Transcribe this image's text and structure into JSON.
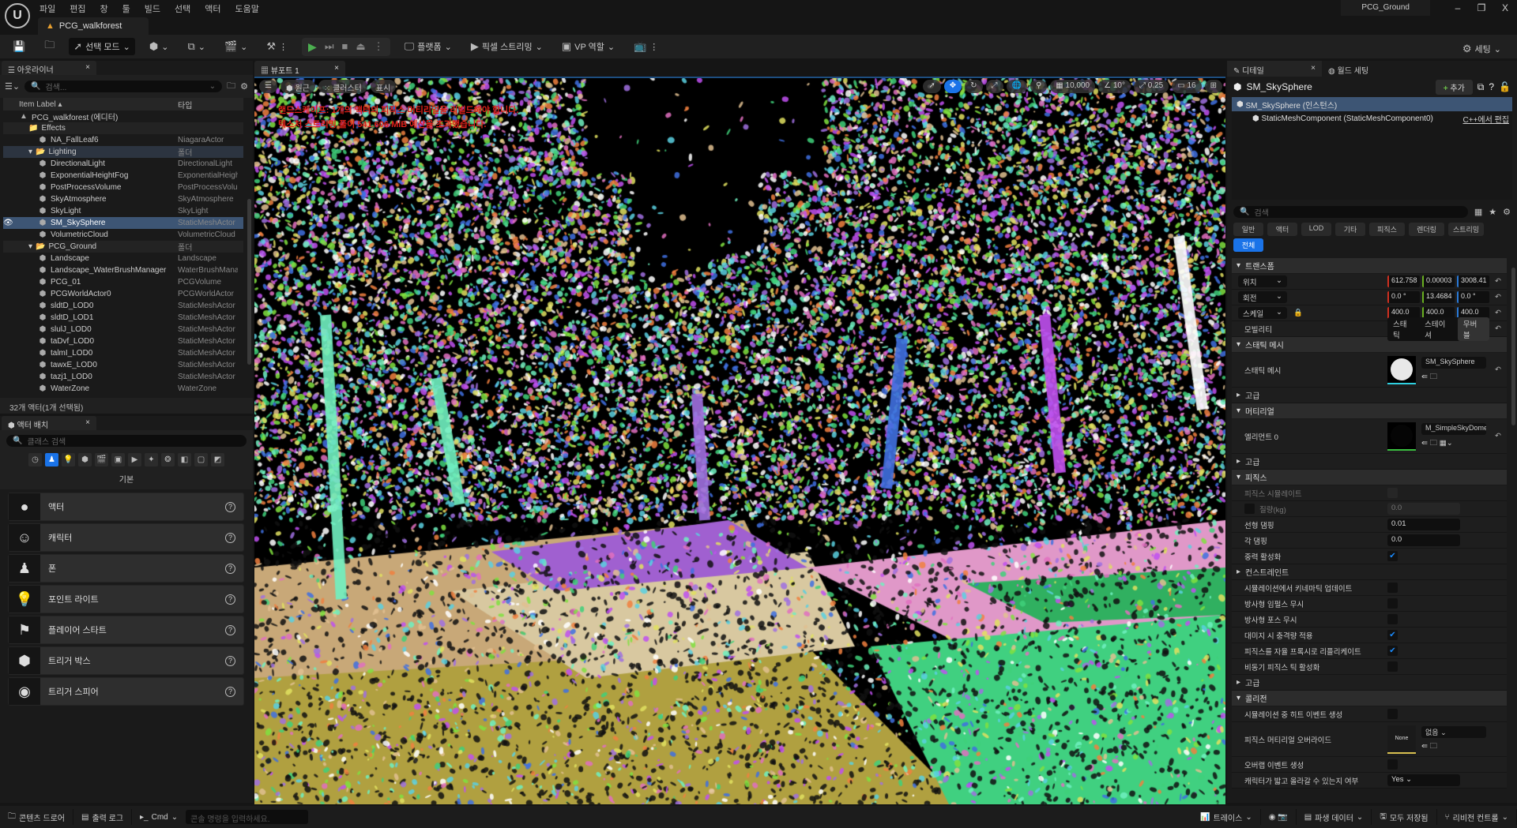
{
  "menu": [
    "파일",
    "편집",
    "창",
    "툴",
    "빌드",
    "선택",
    "액터",
    "도움말"
  ],
  "document_tab": "PCG_walkforest",
  "project_name": "PCG_Ground",
  "window_controls": [
    "–",
    "❐",
    "X"
  ],
  "toolbar": {
    "select_mode": "선택 모드",
    "platform": "플랫폼",
    "pixel_streaming": "픽셀 스트리밍",
    "vp_role": "VP 역할",
    "settings": "세팅"
  },
  "outliner": {
    "tab": "아웃라이너",
    "search_placeholder": "검색...",
    "col_label": "Item Label ▴",
    "col_type": "타입",
    "rows": [
      {
        "label": "PCG_walkforest (에디터)",
        "type": "",
        "indent": 1,
        "kind": "world"
      },
      {
        "label": "Effects",
        "type": "",
        "indent": 2,
        "kind": "folder"
      },
      {
        "label": "NA_FallLeaf6",
        "type": "NiagaraActor",
        "indent": 3,
        "kind": "item"
      },
      {
        "label": "Lighting",
        "type": "폴더",
        "indent": 2,
        "kind": "folder-open"
      },
      {
        "label": "DirectionalLight",
        "type": "DirectionalLight",
        "indent": 3,
        "kind": "item"
      },
      {
        "label": "ExponentialHeightFog",
        "type": "ExponentialHeigh",
        "indent": 3,
        "kind": "item"
      },
      {
        "label": "PostProcessVolume",
        "type": "PostProcessVolu",
        "indent": 3,
        "kind": "item"
      },
      {
        "label": "SkyAtmosphere",
        "type": "SkyAtmosphere",
        "indent": 3,
        "kind": "item"
      },
      {
        "label": "SkyLight",
        "type": "SkyLight",
        "indent": 3,
        "kind": "item"
      },
      {
        "label": "SM_SkySphere",
        "type": "StaticMeshActor",
        "indent": 3,
        "kind": "selected"
      },
      {
        "label": "VolumetricCloud",
        "type": "VolumetricCloud",
        "indent": 3,
        "kind": "item"
      },
      {
        "label": "PCG_Ground",
        "type": "폴더",
        "indent": 2,
        "kind": "folder-open"
      },
      {
        "label": "Landscape",
        "type": "Landscape",
        "indent": 3,
        "kind": "item"
      },
      {
        "label": "Landscape_WaterBrushManager",
        "type": "WaterBrushMana",
        "indent": 3,
        "kind": "item"
      },
      {
        "label": "PCG_01",
        "type": "PCGVolume",
        "indent": 3,
        "kind": "item"
      },
      {
        "label": "PCGWorldActor0",
        "type": "PCGWorldActor",
        "indent": 3,
        "kind": "item"
      },
      {
        "label": "sldtD_LOD0",
        "type": "StaticMeshActor",
        "indent": 3,
        "kind": "item"
      },
      {
        "label": "sldtD_LOD1",
        "type": "StaticMeshActor",
        "indent": 3,
        "kind": "item"
      },
      {
        "label": "slulJ_LOD0",
        "type": "StaticMeshActor",
        "indent": 3,
        "kind": "item"
      },
      {
        "label": "taDvf_LOD0",
        "type": "StaticMeshActor",
        "indent": 3,
        "kind": "item"
      },
      {
        "label": "talmI_LOD0",
        "type": "StaticMeshActor",
        "indent": 3,
        "kind": "item"
      },
      {
        "label": "tawxE_LOD0",
        "type": "StaticMeshActor",
        "indent": 3,
        "kind": "item"
      },
      {
        "label": "tazj1_LOD0",
        "type": "StaticMeshActor",
        "indent": 3,
        "kind": "item"
      },
      {
        "label": "WaterZone",
        "type": "WaterZone",
        "indent": 3,
        "kind": "item"
      }
    ],
    "footer": "32개 액터(1개 선택됨)"
  },
  "placer": {
    "tab": "액터 배치",
    "search_placeholder": "클래스 검색",
    "category": "기본",
    "items": [
      {
        "label": "액터",
        "icon": "●"
      },
      {
        "label": "캐릭터",
        "icon": "☺"
      },
      {
        "label": "폰",
        "icon": "♟"
      },
      {
        "label": "포인트 라이트",
        "icon": "💡"
      },
      {
        "label": "플레이어 스타트",
        "icon": "⚑"
      },
      {
        "label": "트리거 박스",
        "icon": "⬢"
      },
      {
        "label": "트리거 스피어",
        "icon": "◉"
      }
    ]
  },
  "viewport": {
    "tab": "뷰포트 1",
    "perspective": "원근",
    "cluster": "클러스터",
    "show": "표시",
    "grid_snap": "10,000",
    "rot_snap": "10°",
    "scale_snap": "0.25",
    "cam_speed": "16",
    "warnings": [
      "랜드스케이프: 1개의 액터의 피직스 머티리얼을 리빌드해야 합니다.",
      "텍스처 스트리밍 풀이 541.606 MiB 예산을 초과했습니다."
    ]
  },
  "details": {
    "tab": "디테일",
    "tab2": "월드 세팅",
    "actor": "SM_SkySphere",
    "add": "추가",
    "instance": "SM_SkySphere (인스턴스)",
    "component": "StaticMeshComponent (StaticMeshComponent0)",
    "edit_cpp": "C++에서 편집",
    "search_placeholder": "검색",
    "filters": [
      "일반",
      "액터",
      "LOD",
      "기타",
      "피직스",
      "렌더링",
      "스트리밍",
      "전체"
    ],
    "transform": {
      "title": "트랜스폼",
      "location": "위치",
      "rotation": "회전",
      "scale": "스케일",
      "loc": [
        "612.758",
        "0.00003",
        "3008.41"
      ],
      "rot": [
        "0.0 °",
        "13.4684",
        "0.0 °"
      ],
      "scl": [
        "400.0",
        "400.0",
        "400.0"
      ],
      "mobility": "모빌리티",
      "mobility_opts": [
        "스태틱",
        "스테이셔",
        "무버블"
      ]
    },
    "static_mesh": {
      "title": "스태틱 메시",
      "label": "스태틱 메시",
      "value": "SM_SkySphere",
      "advanced": "고급"
    },
    "materials": {
      "title": "머티리얼",
      "label": "엘리먼트 0",
      "value": "M_SimpleSkyDome",
      "advanced": "고급"
    },
    "physics": {
      "title": "피직스",
      "simulate": "피직스 시뮬레이트",
      "mass": "질량(kg)",
      "mass_val": "0.0",
      "lin_damp": "선형 댐핑",
      "lin_damp_val": "0.01",
      "ang_damp": "각 댐핑",
      "ang_damp_val": "0.0",
      "gravity": "중력 활성화",
      "constraints": "컨스트레인트",
      "kinematic": "시뮬레이션에서 키네마틱 업데이트",
      "ign_imp": "방사형 임펄스 무시",
      "ign_force": "방사형 포스 무시",
      "dmg": "대미지 시 충격량 적용",
      "replicate": "피직스를 자율 프록시로 리플리케이트",
      "async": "비동기 피직스 틱 활성화",
      "advanced": "고급"
    },
    "collision": {
      "title": "콜리전",
      "hit": "시뮬레이션 중 히트 이벤트 생성",
      "phys_mat": "피직스 머티리얼 오버라이드",
      "none": "None",
      "none_drop": "없음",
      "overlap": "오버랩 이벤트 생성",
      "step": "캐릭터가 밟고 올라갈 수 있는지 여부",
      "step_val": "Yes"
    }
  },
  "statusbar": {
    "content_drawer": "콘텐츠 드로어",
    "output_log": "출력 로그",
    "cmd": "Cmd",
    "cmd_placeholder": "콘솔 명령을 입력하세요.",
    "trace": "트레이스",
    "derived": "파생 데이터",
    "saved": "모두 저장됨",
    "revision": "리비전 컨트롤"
  },
  "colors": {
    "accent": "#1a73e8",
    "selected_row": "#3d5574",
    "warning": "#e0201a"
  }
}
